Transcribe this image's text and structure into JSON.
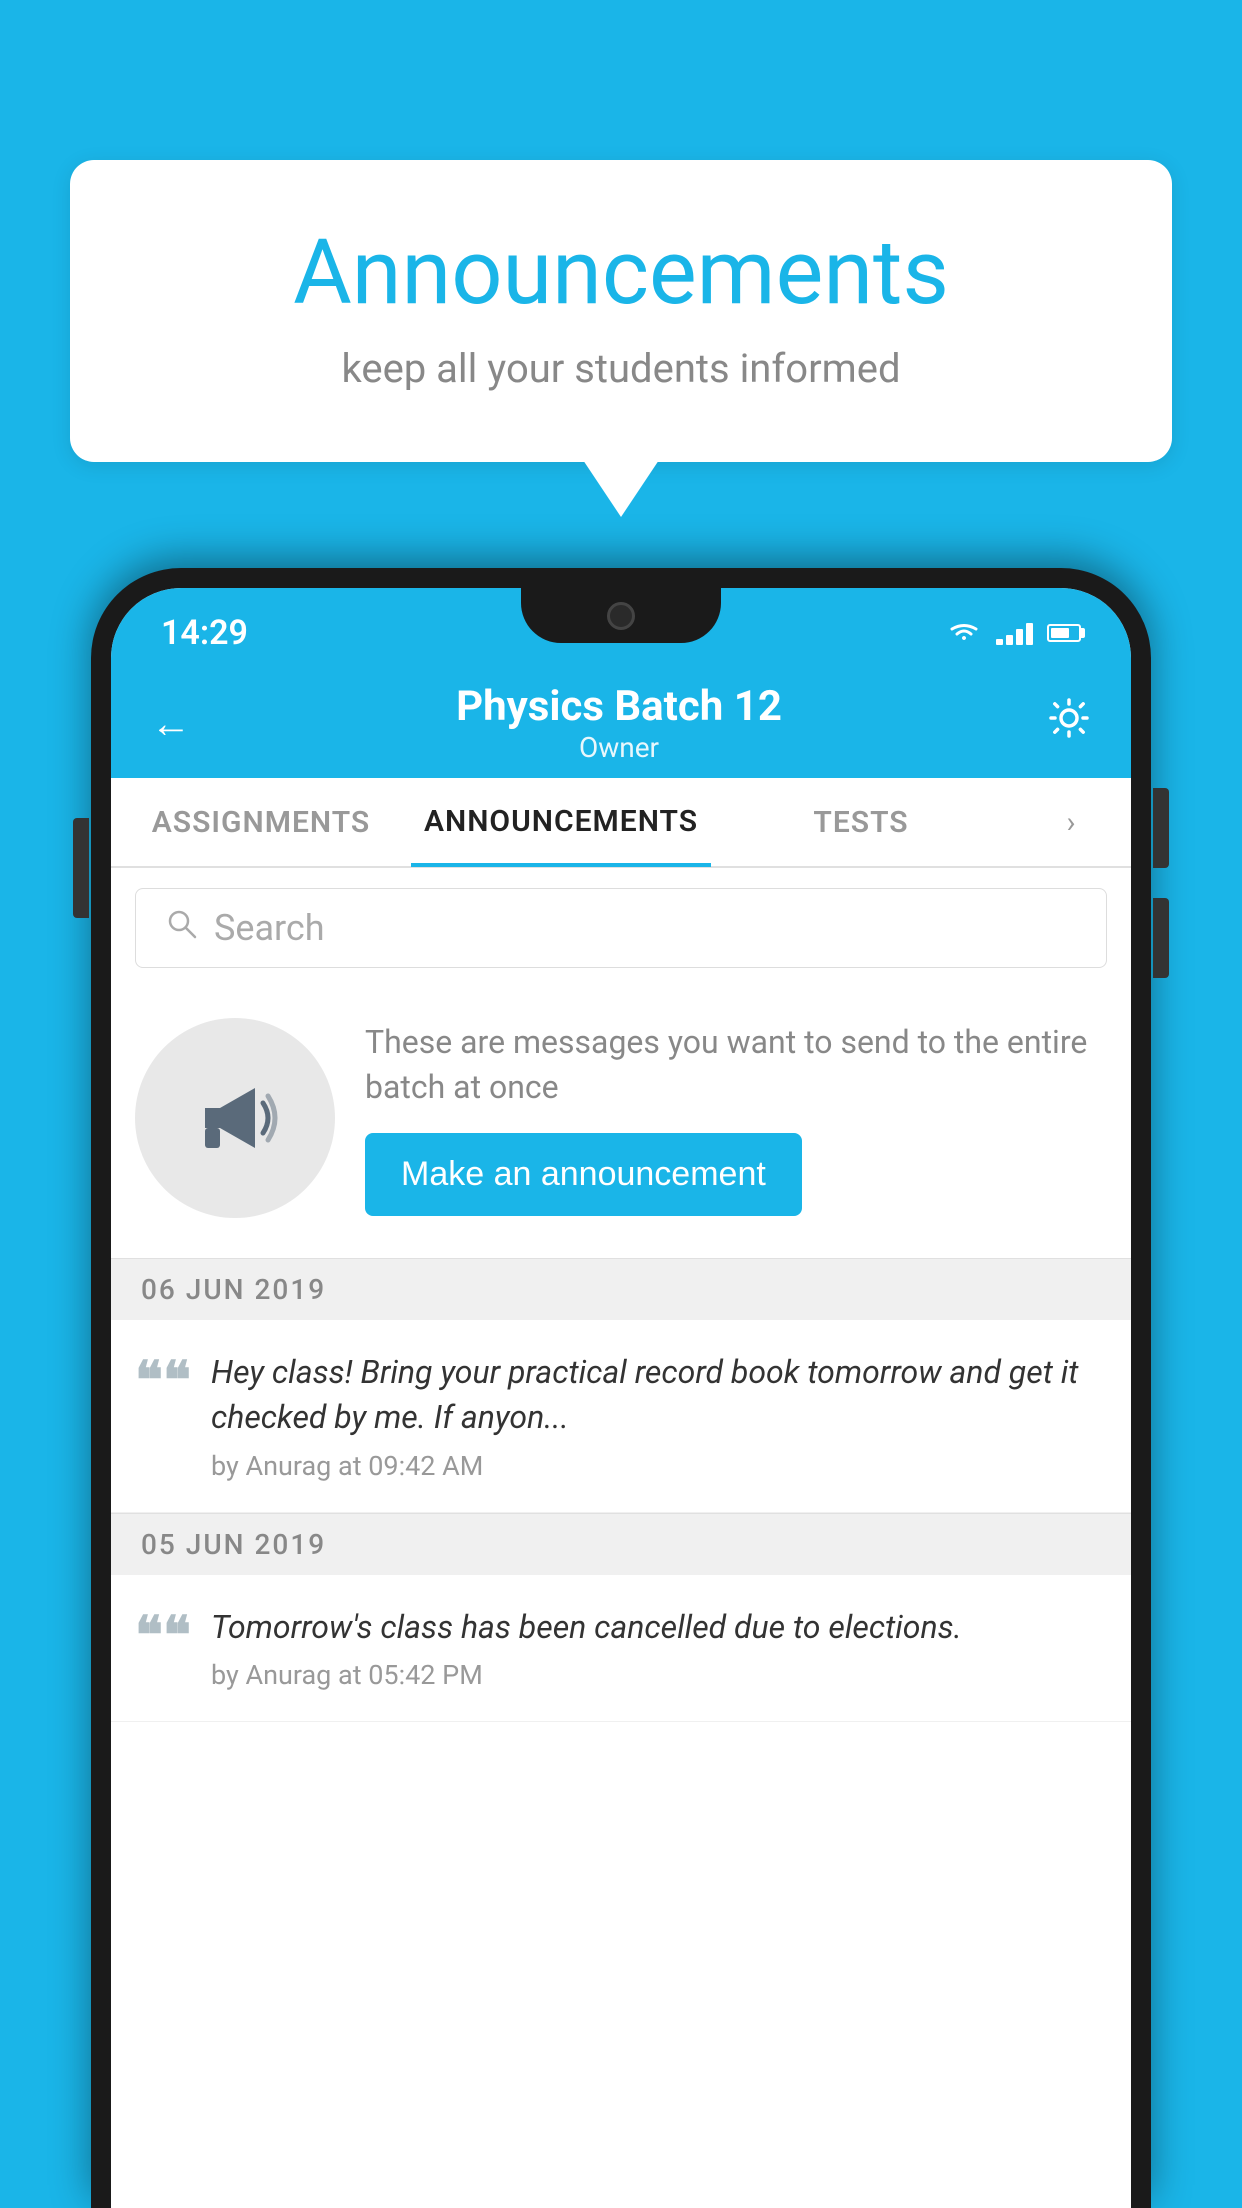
{
  "bubble": {
    "title": "Announcements",
    "subtitle": "keep all your students informed"
  },
  "statusBar": {
    "time": "14:29"
  },
  "header": {
    "title": "Physics Batch 12",
    "subtitle": "Owner"
  },
  "tabs": [
    {
      "label": "ASSIGNMENTS",
      "active": false
    },
    {
      "label": "ANNOUNCEMENTS",
      "active": true
    },
    {
      "label": "TESTS",
      "active": false
    }
  ],
  "search": {
    "placeholder": "Search"
  },
  "promo": {
    "text": "These are messages you want to send to the entire batch at once",
    "buttonLabel": "Make an announcement"
  },
  "announcements": [
    {
      "date": "06  JUN  2019",
      "text": "Hey class! Bring your practical record book tomorrow and get it checked by me. If anyon...",
      "meta": "by Anurag at 09:42 AM"
    },
    {
      "date": "05  JUN  2019",
      "text": "Tomorrow's class has been cancelled due to elections.",
      "meta": "by Anurag at 05:42 PM"
    }
  ]
}
